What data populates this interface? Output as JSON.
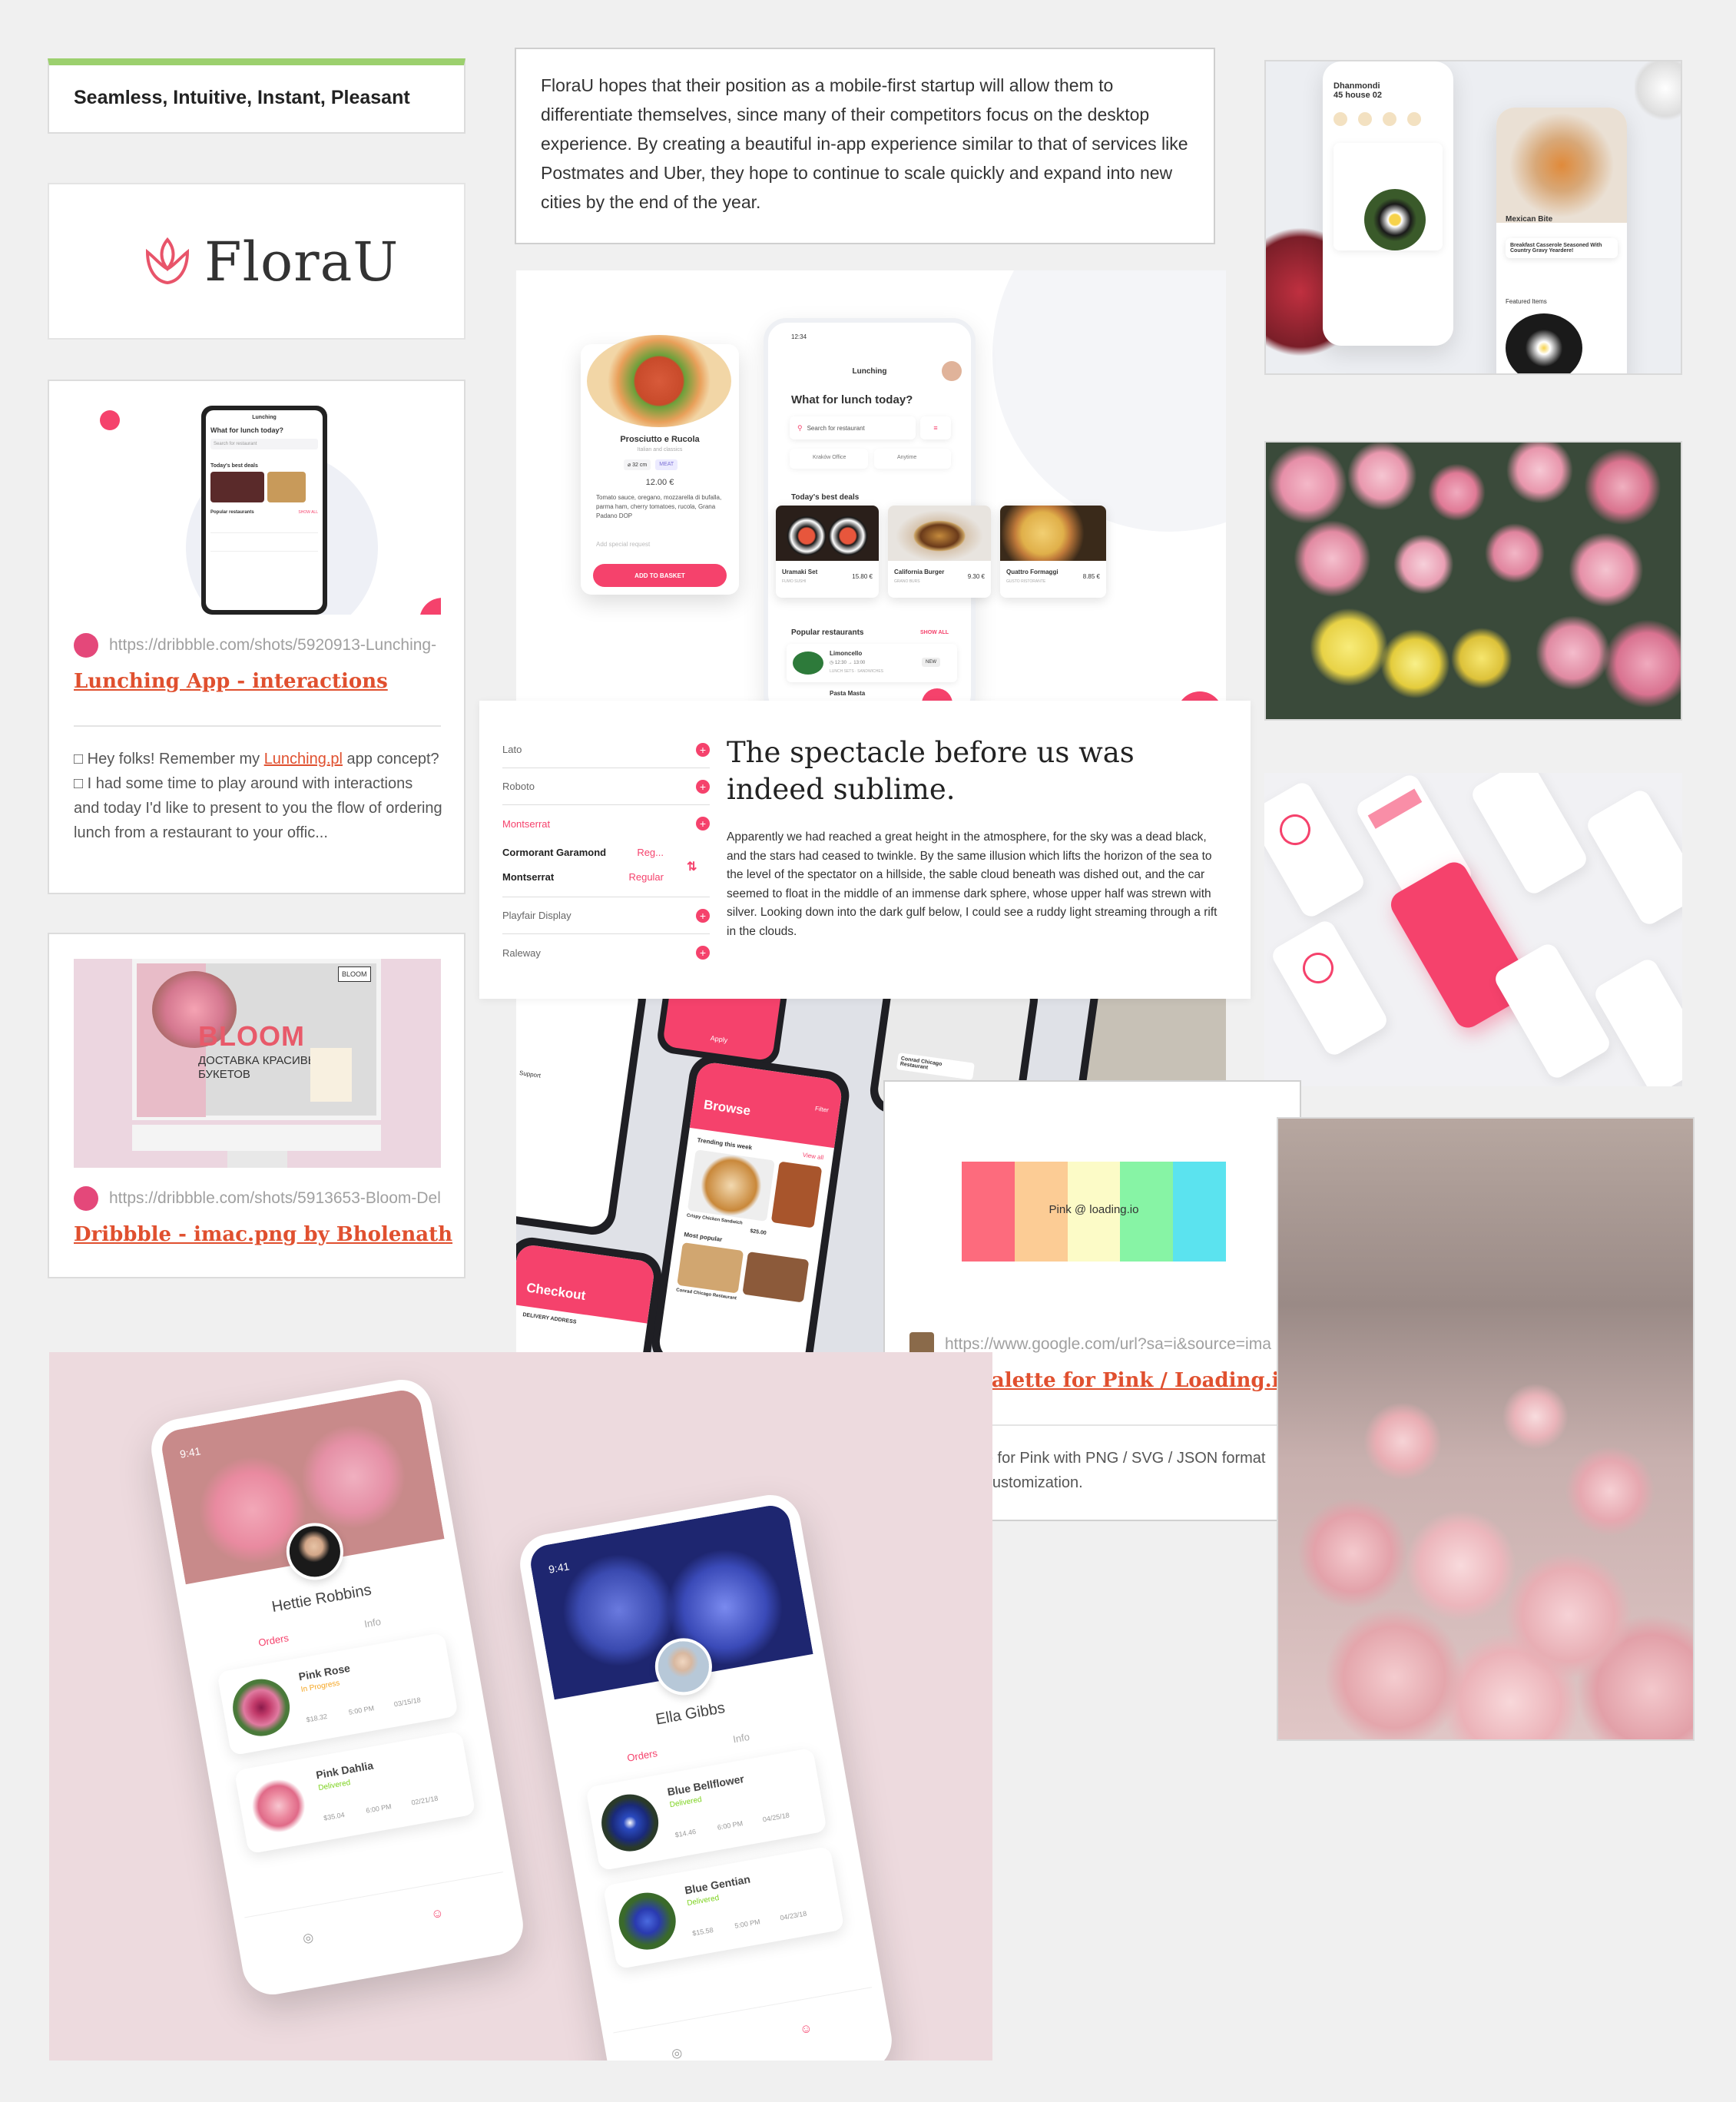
{
  "tagline": "Seamless, Intuitive, Instant, Pleasant",
  "logo": {
    "text": "FloraU"
  },
  "description": "FloraU hopes that their position as a mobile-first startup will allow them to differentiate themselves, since many of their competitors focus on the desktop experience. By creating a beautiful in-app experience similar to that of services like Postmates and Uber, they hope to continue to scale quickly and expand into new cities by the end of the year.",
  "lunching_card": {
    "url": "https://dribbble.com/shots/5920913-Lunching-",
    "title": "Lunching App - interactions",
    "desc_pre": "□ Hey folks! Remember my ",
    "desc_link": "Lunching.pl",
    "desc_post": " app concept? □ I had some time to play around with interactions and today I'd like to present to you the flow of ordering lunch from a restaurant to your offic...",
    "mini_app_title": "Lunching",
    "mini_heading": "What for lunch today?",
    "mini_search": "Search for restaurant",
    "mini_deals": "Today's best deals",
    "mini_popular": "Popular restaurants",
    "mini_show_all": "SHOW ALL"
  },
  "imac_card": {
    "url": "https://dribbble.com/shots/5913653-Bloom-Del",
    "title": "Dribbble - imac.png by Bholenath",
    "bloom": "BLOOM",
    "bloom_sub1": "ДОСТАВКА КРАСИВЫХ",
    "bloom_sub2": "БУКЕТОВ",
    "bloom_logo": "BLOOM"
  },
  "lunch_app": {
    "pizza_name": "Prosciutto e Rucola",
    "pizza_sub": "Italian and classics",
    "pizza_size": "⌀ 32 cm",
    "pizza_tag": "MEAT",
    "pizza_price": "12.00 €",
    "pizza_desc": "Tomato sauce, oregano, mozzarella di bufalla, parma ham, cherry tomatoes, rucola, Grana Padano DOP",
    "special": "Add special request",
    "add_button": "ADD TO BASKET",
    "time": "12:34",
    "app_title": "Lunching",
    "heading": "What for lunch today?",
    "search": "Search for restaurant",
    "office": "Kraków Office",
    "anytime": "Anytime",
    "deals_title": "Today's best deals",
    "deals": [
      {
        "name": "Uramaki Set",
        "sub": "FUMO SUSHI",
        "price": "15.80 €"
      },
      {
        "name": "California Burger",
        "sub": "GRANO BURS",
        "price": "9.30 €"
      },
      {
        "name": "Quattro Formaggi",
        "sub": "GUSTO RISTORANTE",
        "price": "8.85 €"
      }
    ],
    "popular": "Popular restaurants",
    "show_all": "SHOW ALL",
    "restaurants": [
      {
        "name": "Limoncello",
        "hours": "◷ 12:30 → 13:00",
        "sub": "LUNCH SETS · SANDWICHES",
        "tag": "NEW"
      },
      {
        "name": "Pasta Masta",
        "hours": "",
        "sub": "",
        "tag": ""
      }
    ]
  },
  "typography": {
    "fonts": [
      {
        "name": "Lato",
        "style": ""
      },
      {
        "name": "Roboto",
        "style": ""
      },
      {
        "name": "Montserrat",
        "style": ""
      },
      {
        "name": "Cormorant Garamond",
        "style": "Reg..."
      },
      {
        "name": "Montserrat",
        "style": "Regular"
      },
      {
        "name": "Playfair Display",
        "style": ""
      },
      {
        "name": "Raleway",
        "style": ""
      }
    ],
    "heading": "The spectacle before us was indeed sublime.",
    "body": "Apparently we had reached a great height in the atmosphere, for the sky was a dead black, and the stars had ceased to twinkle. By the same illusion which lifts the horizon of the sea to the level of the spectator on a hillside, the sable cloud beneath was dished out, and the car seemed to float in the middle of an immense dark sphere, whose upper half was strewn with silver. Looking down into the dark gulf below, I could see a ruddy light streaming through a rift in the clouds."
  },
  "food_app_right": {
    "location1": "Dhanmondi",
    "location2": "45 house 02",
    "rest_name": "Mexican Bite",
    "dish": "Breakfast Casserole Seasoned With Country Gravy Yeardere!",
    "featured": "Featured Items"
  },
  "browse_app": {
    "apply": "Apply",
    "browse": "Browse",
    "filter": "Filter",
    "trending": "Trending this week",
    "view_all": "View all",
    "dish1": "Crispy Chicken Sandwich",
    "dish1_price": "$25.00",
    "dish2": "Shrimp Fri...",
    "most_popular": "Most popular",
    "restaurant": "Conrad Chicago Restaurant",
    "checkout": "Checkout",
    "delivery": "DELIVERY ADDRESS",
    "support": "Support",
    "map_label": "Conrad Chicago Restaurant"
  },
  "palette_card": {
    "label": "Pink @ loading.io",
    "colors": [
      "#fd6b7d",
      "#fccc95",
      "#fcfbc7",
      "#87f4a5",
      "#5be3ef"
    ],
    "url": "https://www.google.com/url?sa=i&source=ima",
    "title": "Color Palette for Pink / Loading.io",
    "desc": "color palette for Pink with PNG / SVG / JSON format and online customization."
  },
  "profile_left": {
    "time": "9:41",
    "name": "Hettie Robbins",
    "tab_orders": "Orders",
    "tab_info": "Info",
    "orders": [
      {
        "name": "Pink Rose",
        "status": "In Progress",
        "price": "$18.32",
        "time": "5:00 PM",
        "date": "03/15/18"
      },
      {
        "name": "Pink Dahlia",
        "status": "Delivered",
        "price": "$35.04",
        "time": "6:00 PM",
        "date": "02/21/18"
      }
    ]
  },
  "profile_right": {
    "time": "9:41",
    "name": "Ella Gibbs",
    "tab_orders": "Orders",
    "tab_info": "Info",
    "orders": [
      {
        "name": "Blue Bellflower",
        "status": "Delivered",
        "price": "$14.46",
        "time": "6:00 PM",
        "date": "04/25/18"
      },
      {
        "name": "Blue Gentian",
        "status": "Delivered",
        "price": "$15.58",
        "time": "5:00 PM",
        "date": "04/23/18"
      }
    ]
  },
  "colors": {
    "accent": "#f5426c",
    "link": "#e0502f",
    "green_bar": "#9cd06e",
    "order_status_progress": "#f5a623",
    "order_status_delivered": "#7ed321"
  }
}
